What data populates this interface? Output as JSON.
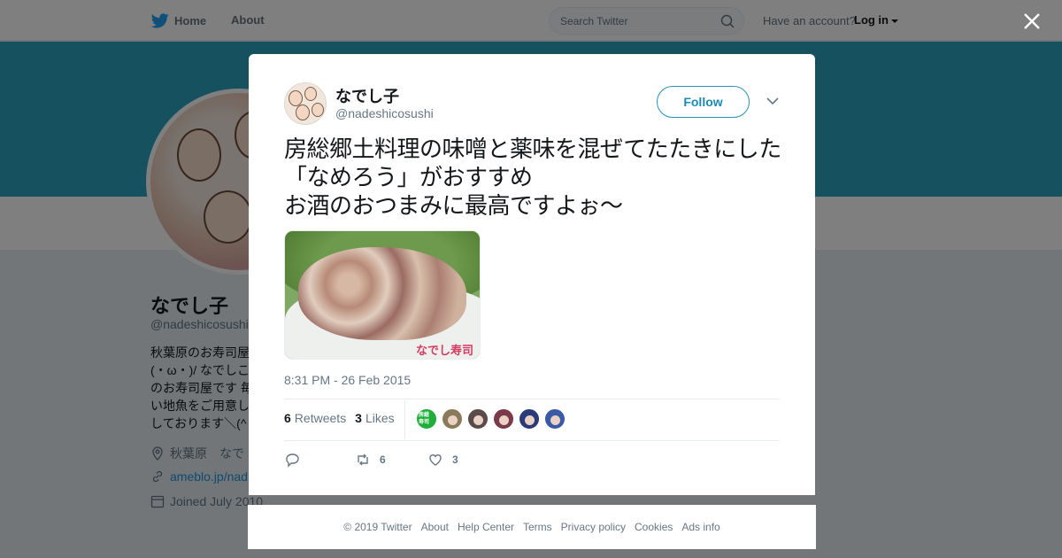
{
  "topnav": {
    "home_label": "Home",
    "about_label": "About",
    "search_placeholder": "Search Twitter",
    "have_account": "Have an account?",
    "login_label": "Log in"
  },
  "profile": {
    "name": "なでし子",
    "handle": "@nadeshicosushi",
    "bio": "秋葉原のお寿司屋\n(・ω・)/ なでしこ\nのお寿司屋です 毎\nい地魚をご用意し\nしております＼(^",
    "location": "秋葉原　なで",
    "url": "ameblo.jp/nad",
    "joined": "Joined July 2010"
  },
  "tweet": {
    "author_name": "なでし子",
    "author_handle": "@nadeshicosushi",
    "follow_label": "Follow",
    "text": "房総郷土料理の味噌と薬味を混ぜてたたきにした「なめろう」がおすすめ\nお酒のおつまみに最高ですよぉ～",
    "photo_watermark": "なでし寿司",
    "timestamp": "8:31 PM - 26 Feb 2015",
    "retweets_count": "6",
    "retweets_label": "Retweets",
    "likes_count": "3",
    "likes_label": "Likes",
    "reply_count": "",
    "retweet_action_count": "6",
    "like_action_count": "3",
    "liker_avatars": [
      {
        "name": "liker-1",
        "color": "#1fae3a",
        "text": "房総\n寿司"
      },
      {
        "name": "liker-2",
        "color": "#8a7a5a",
        "text": ""
      },
      {
        "name": "liker-3",
        "color": "#5a4a4a",
        "text": ""
      },
      {
        "name": "liker-4",
        "color": "#7a3a4a",
        "text": ""
      },
      {
        "name": "liker-5",
        "color": "#2a3a7a",
        "text": ""
      },
      {
        "name": "liker-6",
        "color": "#3a5aa8",
        "text": ""
      }
    ]
  },
  "footer": {
    "copyright": "© 2019 Twitter",
    "links": [
      "About",
      "Help Center",
      "Terms",
      "Privacy policy",
      "Cookies",
      "Ads info"
    ]
  },
  "colors": {
    "banner": "#2aa3bd",
    "link": "#1b95e0",
    "follow_border": "#2592b8"
  }
}
